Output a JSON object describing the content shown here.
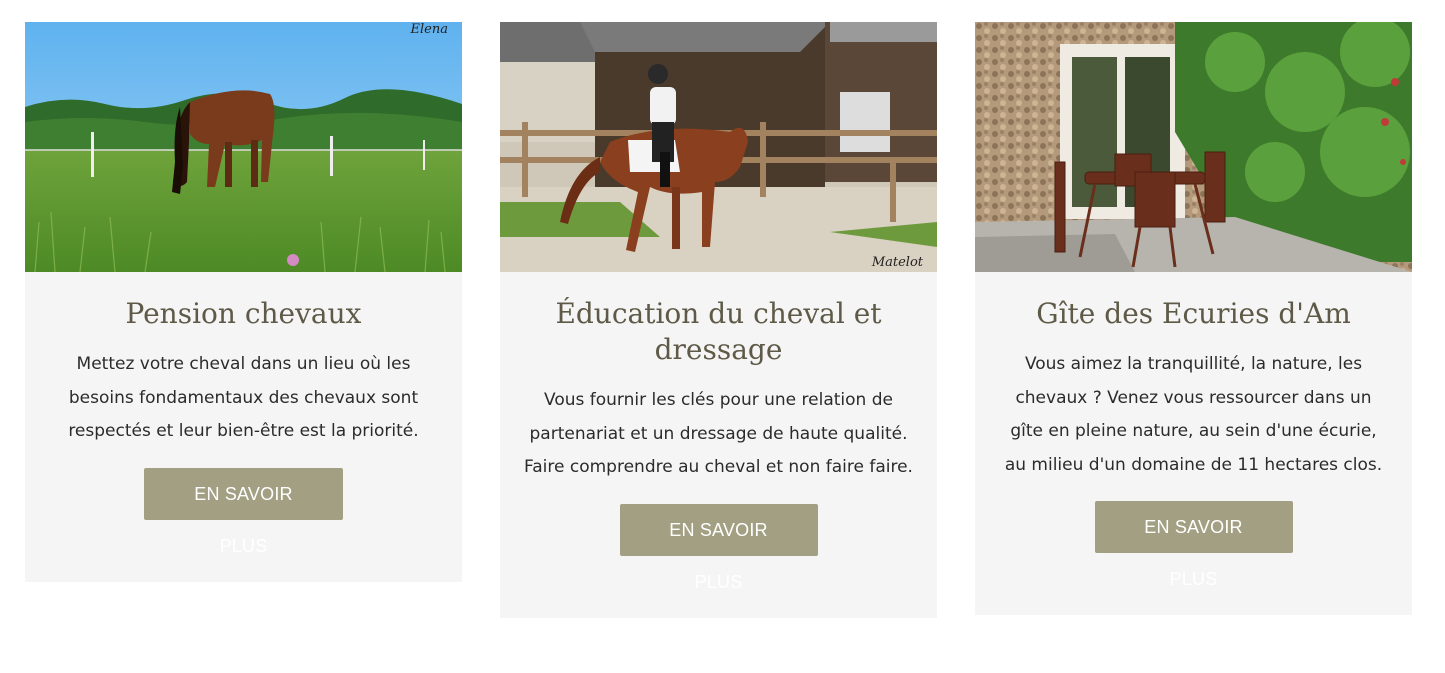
{
  "cards": [
    {
      "title": "Pension chevaux",
      "text": "Mettez votre cheval dans un lieu où les besoins fondamentaux des chevaux sont respectés et leur bien-être est la priorité.",
      "button_label": "EN SAVOIR PLUS",
      "photo_signature": "Elena"
    },
    {
      "title": "Éducation du cheval et dressage",
      "text": "Vous fournir les clés pour une relation de partenariat et un dressage de haute qualité. Faire comprendre au cheval et non faire faire.",
      "button_label": "EN SAVOIR PLUS",
      "photo_signature": "Matelot"
    },
    {
      "title": "Gîte des Ecuries d'Am",
      "text": "Vous aimez la tranquillité, la nature, les chevaux ? Venez vous ressourcer dans un gîte en pleine nature, au sein d'une écurie, au milieu d'un domaine de 11 hectares clos.",
      "button_label": "EN SAVOIR PLUS"
    }
  ],
  "colors": {
    "card_bg": "#f5f5f5",
    "title": "#5e5a47",
    "button_bg": "#a29f83",
    "button_text": "#ffffff"
  }
}
